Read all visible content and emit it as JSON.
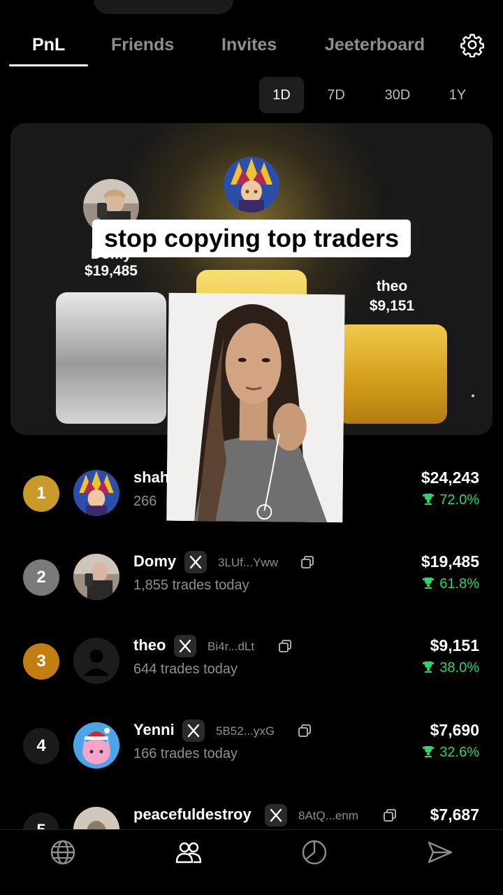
{
  "tabs": [
    {
      "label": "PnL",
      "active": true
    },
    {
      "label": "Friends",
      "active": false
    },
    {
      "label": "Invites",
      "active": false
    },
    {
      "label": "Jeeterboard",
      "active": false
    }
  ],
  "periods": [
    {
      "label": "1D",
      "active": true
    },
    {
      "label": "7D",
      "active": false
    },
    {
      "label": "30D",
      "active": false
    },
    {
      "label": "1Y",
      "active": false
    }
  ],
  "podium": {
    "second": {
      "name": "Domy",
      "amount": "$19,485",
      "avatar": "photo-avatar"
    },
    "first": {
      "avatar": "yugi-avatar"
    },
    "third": {
      "name": "theo",
      "amount": "$9,151",
      "avatar": "placeholder-avatar"
    }
  },
  "caption": "stop copying top traders",
  "leaderboard": [
    {
      "rank": "1",
      "name": "shah",
      "address": "",
      "trades": "266",
      "pnl": "$24,243",
      "pct": "72.0%",
      "avatar": "yugi-avatar"
    },
    {
      "rank": "2",
      "name": "Domy",
      "address": "3LUf...Yww",
      "trades": "1,855 trades today",
      "pnl": "$19,485",
      "pct": "61.8%",
      "avatar": "photo-avatar"
    },
    {
      "rank": "3",
      "name": "theo",
      "address": "Bi4r...dLt",
      "trades": "644 trades today",
      "pnl": "$9,151",
      "pct": "38.0%",
      "avatar": "placeholder-avatar"
    },
    {
      "rank": "4",
      "name": "Yenni",
      "address": "5B52...yxG",
      "trades": "166 trades today",
      "pnl": "$7,690",
      "pct": "32.6%",
      "avatar": "pink-cat-avatar"
    },
    {
      "rank": "5",
      "name": "peacefuldestroy",
      "address": "8AtQ...enm",
      "trades": "",
      "pnl": "$7,687",
      "pct": "",
      "avatar": "photo-avatar"
    }
  ],
  "nav": [
    "globe-icon",
    "friends-icon",
    "portfolio-icon",
    "send-icon"
  ],
  "colors": {
    "gain": "#2fd36e",
    "gold": "#c99a28",
    "silver": "#7a7a7a",
    "bronze": "#c27e0e"
  }
}
